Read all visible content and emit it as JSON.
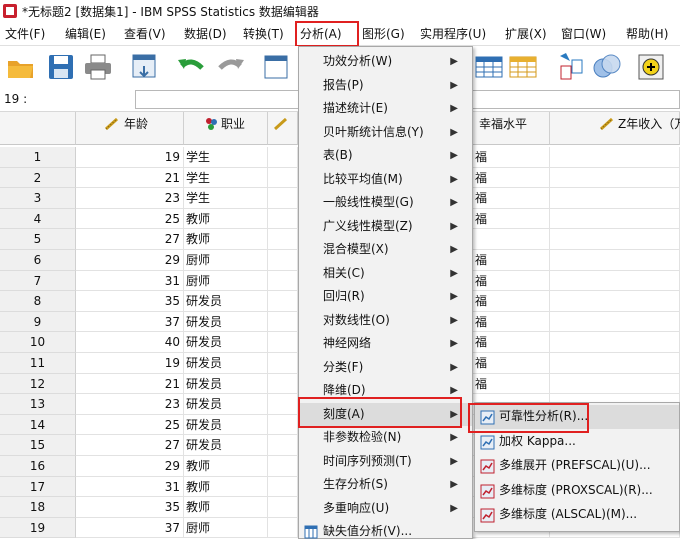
{
  "titlebar": {
    "title": "*无标题2 [数据集1] - IBM SPSS Statistics 数据编辑器"
  },
  "menubar": {
    "items": [
      "文件(F)",
      "编辑(E)",
      "查看(V)",
      "数据(D)",
      "转换(T)",
      "分析(A)",
      "图形(G)",
      "实用程序(U)",
      "扩展(X)",
      "窗口(W)",
      "帮助(H)"
    ]
  },
  "cellref": {
    "label": "19 :",
    "value": ""
  },
  "grid": {
    "headers": [
      "年龄",
      "职业",
      "",
      "幸福水平",
      "Z年收入（万"
    ],
    "rows": [
      {
        "n": "1",
        "age": "19",
        "job": "学生",
        "happy": "福"
      },
      {
        "n": "2",
        "age": "21",
        "job": "学生",
        "happy": "福"
      },
      {
        "n": "3",
        "age": "23",
        "job": "学生",
        "happy": "福"
      },
      {
        "n": "4",
        "age": "25",
        "job": "教师",
        "happy": "福"
      },
      {
        "n": "5",
        "age": "27",
        "job": "教师",
        "happy": ""
      },
      {
        "n": "6",
        "age": "29",
        "job": "厨师",
        "happy": "福"
      },
      {
        "n": "7",
        "age": "31",
        "job": "厨师",
        "happy": "福"
      },
      {
        "n": "8",
        "age": "35",
        "job": "研发员",
        "happy": "福"
      },
      {
        "n": "9",
        "age": "37",
        "job": "研发员",
        "happy": "福"
      },
      {
        "n": "10",
        "age": "40",
        "job": "研发员",
        "happy": "福"
      },
      {
        "n": "11",
        "age": "19",
        "job": "研发员",
        "happy": "福"
      },
      {
        "n": "12",
        "age": "21",
        "job": "研发员",
        "happy": "福"
      },
      {
        "n": "13",
        "age": "23",
        "job": "研发员",
        "happy": ""
      },
      {
        "n": "14",
        "age": "25",
        "job": "研发员",
        "happy": ""
      },
      {
        "n": "15",
        "age": "27",
        "job": "研发员",
        "happy": ""
      },
      {
        "n": "16",
        "age": "29",
        "job": "教师",
        "happy": ""
      },
      {
        "n": "17",
        "age": "31",
        "job": "教师",
        "happy": ""
      },
      {
        "n": "18",
        "age": "35",
        "job": "教师",
        "happy": ""
      },
      {
        "n": "19",
        "age": "37",
        "job": "厨师",
        "happy": ""
      }
    ]
  },
  "analyze_menu": {
    "items": [
      {
        "label": "功效分析(W)",
        "submenu": true
      },
      {
        "label": "报告(P)",
        "submenu": true
      },
      {
        "label": "描述统计(E)",
        "submenu": true
      },
      {
        "label": "贝叶斯统计信息(Y)",
        "submenu": true
      },
      {
        "label": "表(B)",
        "submenu": true
      },
      {
        "label": "比较平均值(M)",
        "submenu": true
      },
      {
        "label": "一般线性模型(G)",
        "submenu": true
      },
      {
        "label": "广义线性模型(Z)",
        "submenu": true
      },
      {
        "label": "混合模型(X)",
        "submenu": true
      },
      {
        "label": "相关(C)",
        "submenu": true
      },
      {
        "label": "回归(R)",
        "submenu": true
      },
      {
        "label": "对数线性(O)",
        "submenu": true
      },
      {
        "label": "神经网络",
        "submenu": true
      },
      {
        "label": "分类(F)",
        "submenu": true
      },
      {
        "label": "降维(D)",
        "submenu": true
      },
      {
        "label": "刻度(A)",
        "submenu": true,
        "active": true
      },
      {
        "label": "非参数检验(N)",
        "submenu": true
      },
      {
        "label": "时间序列预测(T)",
        "submenu": true
      },
      {
        "label": "生存分析(S)",
        "submenu": true
      },
      {
        "label": "多重响应(U)",
        "submenu": true
      },
      {
        "label": "缺失值分析(V)...",
        "submenu": false
      }
    ]
  },
  "scale_submenu": {
    "items": [
      {
        "label": "可靠性分析(R)...",
        "icon": "reliability-icon",
        "active": true
      },
      {
        "label": "加权 Kappa...",
        "icon": "kappa-icon"
      },
      {
        "label": "多维展开 (PREFSCAL)(U)...",
        "icon": "prefscal-icon"
      },
      {
        "label": "多维标度 (PROXSCAL)(R)...",
        "icon": "proxscal-icon"
      },
      {
        "label": "多维标度 (ALSCAL)(M)...",
        "icon": "alscal-icon"
      }
    ]
  },
  "colors": {
    "highlight_box": "#e02020",
    "menu_bg": "#f2f2f2",
    "active_row": "#dcdcdc"
  }
}
